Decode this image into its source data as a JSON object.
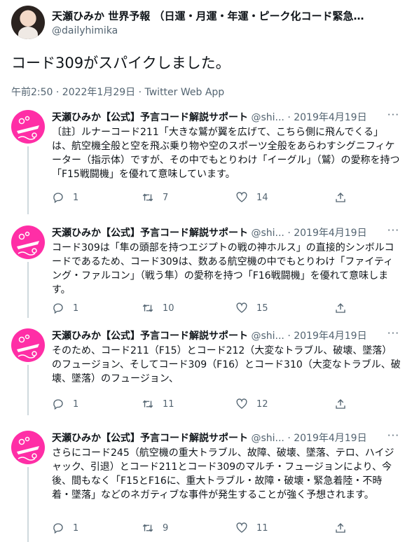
{
  "main": {
    "author_name": "天瀬ひみか 世界予報 （日運・月運・年運・ピーク化コード緊急警…",
    "author_handle": "@dailyhimika",
    "text": "コード309がスパイクしました。",
    "meta": "午前2:50 · 2022年1月29日 · Twitter Web App"
  },
  "replies": [
    {
      "name": "天瀬ひみか【公式】予言コード解説サポート",
      "handle": "@shi...",
      "separator": "·",
      "date": "2019年4月19日",
      "more": "···",
      "text": "〔註〕ルナーコード211「大きな鷲が翼を広げて、こちら側に飛んでくる」は、航空機全般と空を飛ぶ乗り物や空のスポーツ全般をあらわすシグニフィケーター（指示体）ですが、その中でもとりわけ「イーグル」（鷲）の愛称を持つ「F15戦闘機」を優れて意味しています。",
      "reply_count": "1",
      "retweet_count": "7",
      "like_count": "14"
    },
    {
      "name": "天瀬ひみか【公式】予言コード解説サポート",
      "handle": "@shi...",
      "separator": "·",
      "date": "2019年4月19日",
      "more": "···",
      "text": "コード309は「隼の頭部を持つエジプトの戦の神ホルス」の直接的シンボルコードであるため、コード309は、数ある航空機の中でもとりわけ「ファイティング・ファルコン」（戦う隼）の愛称を持つ「F16戦闘機」を優れて意味します。",
      "reply_count": "1",
      "retweet_count": "10",
      "like_count": "15"
    },
    {
      "name": "天瀬ひみか【公式】予言コード解説サポート",
      "handle": "@shi...",
      "separator": "·",
      "date": "2019年4月19日",
      "more": "···",
      "text": "そのため、コード211（F15）とコード212（大変なトラブル、破壊、墜落）のフュージョン、そしてコード309（F16）とコード310（大変なトラブル、破壊、墜落）のフュージョン、",
      "reply_count": "1",
      "retweet_count": "11",
      "like_count": "12"
    },
    {
      "name": "天瀬ひみか【公式】予言コード解説サポート",
      "handle": "@shi...",
      "separator": "·",
      "date": "2019年4月19日",
      "more": "···",
      "text": "さらにコード245（航空機の重大トラブル、故障、破壊、墜落、テロ、ハイジャック、引退）とコード211とコード309のマルチ・フュージョンにより、今後、間もなく「F15とF16に、重大トラブル・故障・破壊・緊急着陸・不時着・墜落」などのネガティブな事件が発生することが強く予想されます。",
      "reply_count": "1",
      "retweet_count": "9",
      "like_count": "11"
    }
  ],
  "colors": {
    "text": "#0f1419",
    "secondary": "#536471",
    "avatar_pink": "#ff2ea6",
    "thread_line": "#cfd9de"
  },
  "icons": {
    "reply": "reply-icon",
    "retweet": "retweet-icon",
    "like": "heart-icon",
    "share": "share-icon",
    "more": "more-icon"
  }
}
